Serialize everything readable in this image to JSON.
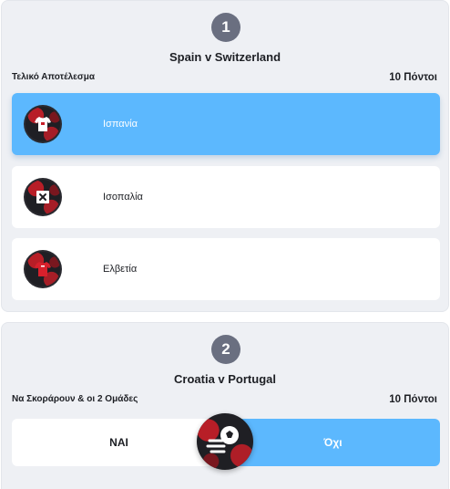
{
  "questions": [
    {
      "number": "1",
      "match": "Spain v Switzerland",
      "market": "Τελικό Αποτέλεσμα",
      "points": "10 Πόντοι",
      "options": [
        {
          "label": "Ισπανία",
          "icon": "spain-shirt-icon",
          "selected": true
        },
        {
          "label": "Ισοπαλία",
          "icon": "draw-x-icon",
          "selected": false
        },
        {
          "label": "Ελβετία",
          "icon": "switzerland-shirt-icon",
          "selected": false
        }
      ]
    },
    {
      "number": "2",
      "match": "Croatia v Portugal",
      "market": "Να Σκοράρουν & οι 2 Ομάδες",
      "points": "10 Πόντοι",
      "yes_label": "ΝΑΙ",
      "no_label": "Όχι",
      "selected": "no",
      "icon": "football-icon"
    }
  ],
  "colors": {
    "selected": "#5cb8fe",
    "card_bg": "#eef0f4",
    "step_badge": "#6a6f80",
    "icon_bg": "#1f1f24",
    "icon_accent": "#c81e28"
  }
}
